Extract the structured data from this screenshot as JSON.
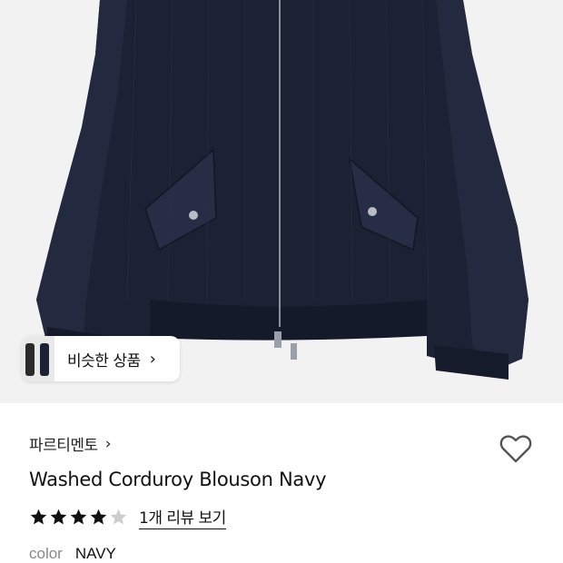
{
  "product": {
    "brand": "파르티멘토",
    "title": "Washed Corduroy Blouson Navy",
    "rating": 4,
    "rating_max": 5,
    "review_link": "1개 리뷰 보기",
    "color_label": "color",
    "color_value": "NAVY"
  },
  "similar_chip": {
    "label": "비슷한 상품"
  },
  "icons": {
    "brand_chevron": "chevron-right-icon",
    "chip_chevron": "chevron-right-icon",
    "like": "heart-outline-icon",
    "star": "star-icon"
  },
  "colors": {
    "jacket": "#1c2133",
    "image_background": "#f2f2f2",
    "star_filled": "#111111",
    "star_empty": "#cccccc"
  }
}
